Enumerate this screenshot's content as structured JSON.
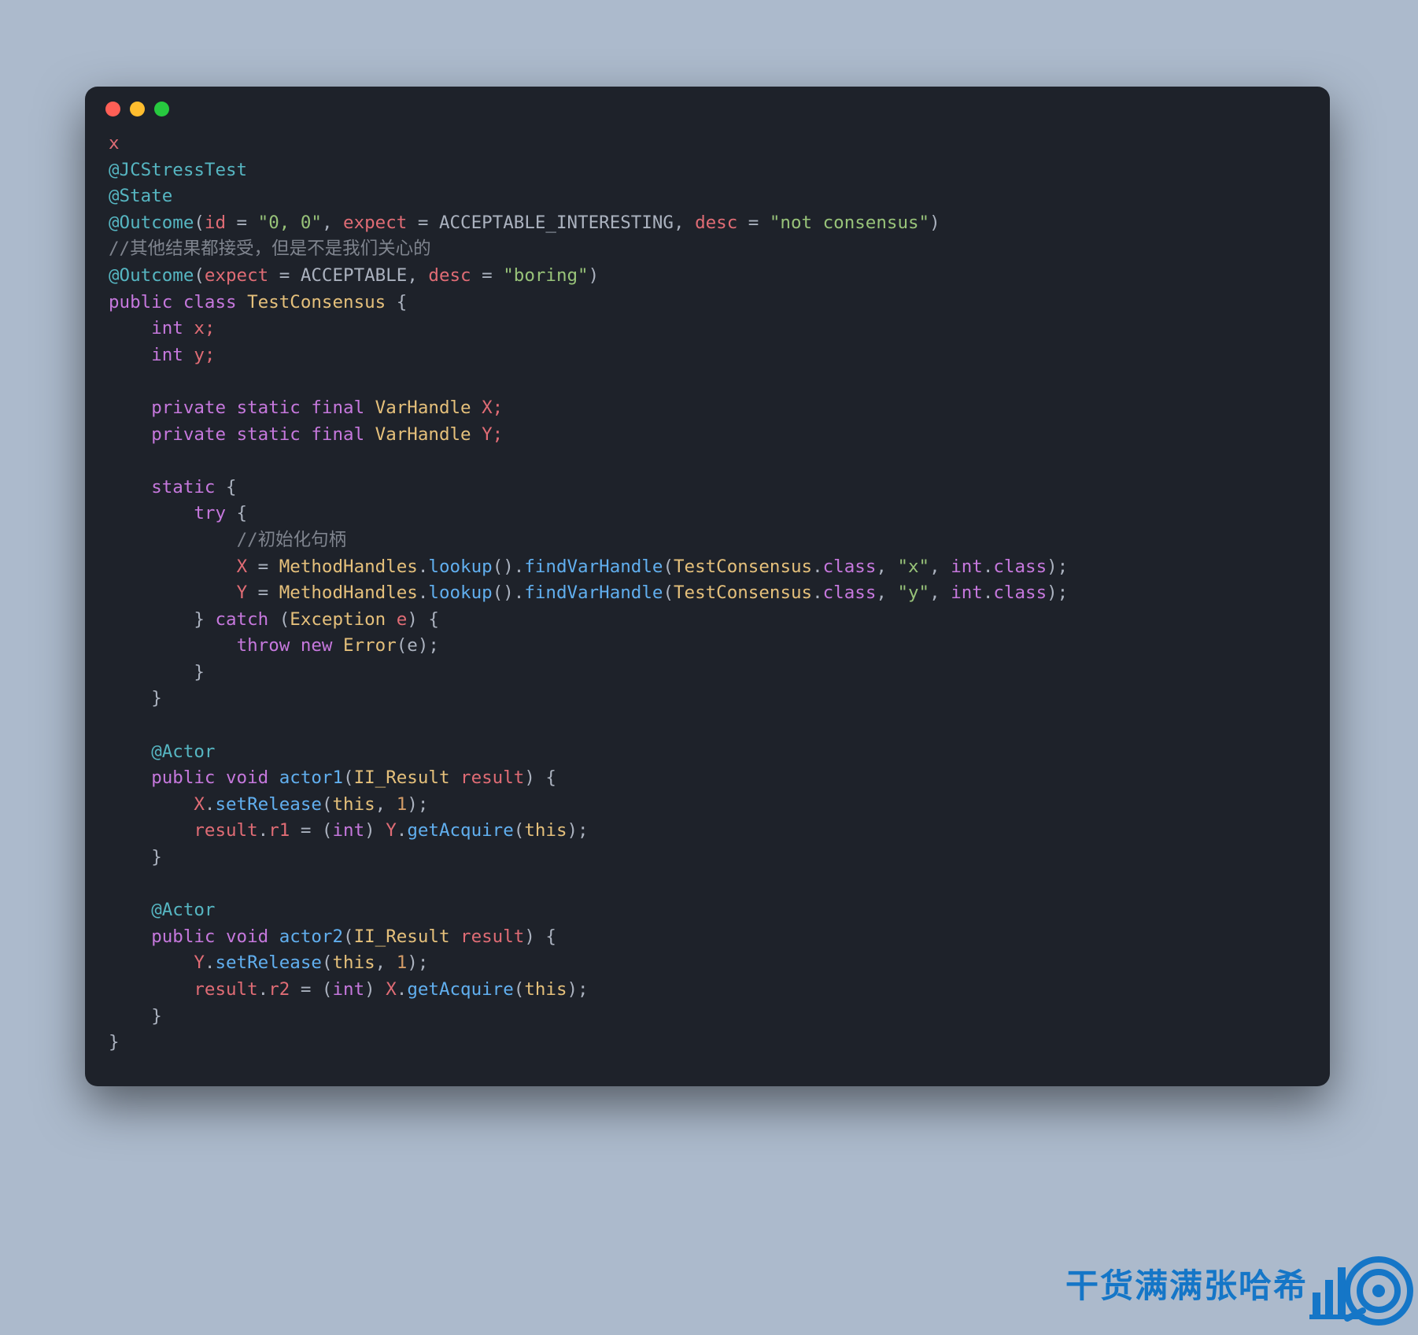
{
  "code": {
    "l1_text": "x",
    "anno_jcstress": "@JCStressTest",
    "anno_state": "@State",
    "outcome1": {
      "at": "@Outcome",
      "open": "(",
      "id_key": "id",
      "eq1": " = ",
      "id_val": "\"0, 0\"",
      "comma1": ", ",
      "expect_key": "expect",
      "eq2": " = ",
      "expect_val": "ACCEPTABLE_INTERESTING",
      "comma2": ", ",
      "desc_key": "desc",
      "eq3": " = ",
      "desc_val": "\"not consensus\"",
      "close": ")"
    },
    "comment1": "//其他结果都接受，但是不是我们关心的",
    "outcome2": {
      "at": "@Outcome",
      "open": "(",
      "expect_key": "expect",
      "eq1": " = ",
      "expect_val": "ACCEPTABLE",
      "comma1": ", ",
      "desc_key": "desc",
      "eq2": " = ",
      "desc_val": "\"boring\"",
      "close": ")"
    },
    "classdecl": {
      "public": "public",
      "class": "class",
      "name": "TestConsensus",
      "brace": " {"
    },
    "field_int": "int",
    "field_x": " x;",
    "field_y": " y;",
    "priv": "private",
    "static": "static",
    "final": "final",
    "varhandle": "VarHandle",
    "vh_x": " X;",
    "vh_y": " Y;",
    "static_brace": " {",
    "try": "try",
    "try_brace": " {",
    "comment2": "//初始化句柄",
    "assign_x": {
      "lhs": "X",
      "eq": " = ",
      "mh": "MethodHandles",
      "dot1": ".",
      "lookup": "lookup",
      "p1": "().",
      "fvh": "findVarHandle",
      "p2": "(",
      "tc": "TestConsensus",
      "dot2": ".",
      "class1": "class",
      "c1": ", ",
      "xs": "\"x\"",
      "c2": ", ",
      "inttype": "int",
      "dot3": ".",
      "class2": "class",
      "end": ");"
    },
    "assign_y": {
      "lhs": "Y",
      "eq": " = ",
      "mh": "MethodHandles",
      "dot1": ".",
      "lookup": "lookup",
      "p1": "().",
      "fvh": "findVarHandle",
      "p2": "(",
      "tc": "TestConsensus",
      "dot2": ".",
      "class1": "class",
      "c1": ", ",
      "ys": "\"y\"",
      "c2": ", ",
      "inttype": "int",
      "dot3": ".",
      "class2": "class",
      "end": ");"
    },
    "close_try": "} ",
    "catch": "catch",
    "catch_open": " (",
    "exception": "Exception",
    "ex_var": " e",
    "catch_close": ") {",
    "throw": "throw",
    "new": "new",
    "error": "Error",
    "error_args": "(e);",
    "brace_c1": "}",
    "brace_c2": "}",
    "anno_actor": "@Actor",
    "actor1": {
      "public": "public",
      "void": "void",
      "name": "actor1",
      "open": "(",
      "type": "II_Result",
      "param": " result",
      "close": ") {"
    },
    "a1_body1": {
      "x": "X",
      "dot": ".",
      "sr": "setRelease",
      "open": "(",
      "this": "this",
      "c": ", ",
      "one": "1",
      "close": ");"
    },
    "a1_body2": {
      "res": "result",
      "dot1": ".",
      "r1": "r1",
      "eq": " = (",
      "cast": "int",
      "close_cast": ") ",
      "y": "Y",
      "dot2": ".",
      "ga": "getAcquire",
      "open": "(",
      "this": "this",
      "close": ");"
    },
    "actor2": {
      "public": "public",
      "void": "void",
      "name": "actor2",
      "open": "(",
      "type": "II_Result",
      "param": " result",
      "close": ") {"
    },
    "a2_body1": {
      "y": "Y",
      "dot": ".",
      "sr": "setRelease",
      "open": "(",
      "this": "this",
      "c": ", ",
      "one": "1",
      "close": ");"
    },
    "a2_body2": {
      "res": "result",
      "dot1": ".",
      "r2": "r2",
      "eq": " = (",
      "cast": "int",
      "close_cast": ") ",
      "x": "X",
      "dot2": ".",
      "ga": "getAcquire",
      "open": "(",
      "this": "this",
      "close": ");"
    },
    "brace_end": "}",
    "indent1": "    ",
    "indent2": "        ",
    "indent3": "            ",
    "sp": " "
  },
  "watermark": "干货满满张哈希"
}
